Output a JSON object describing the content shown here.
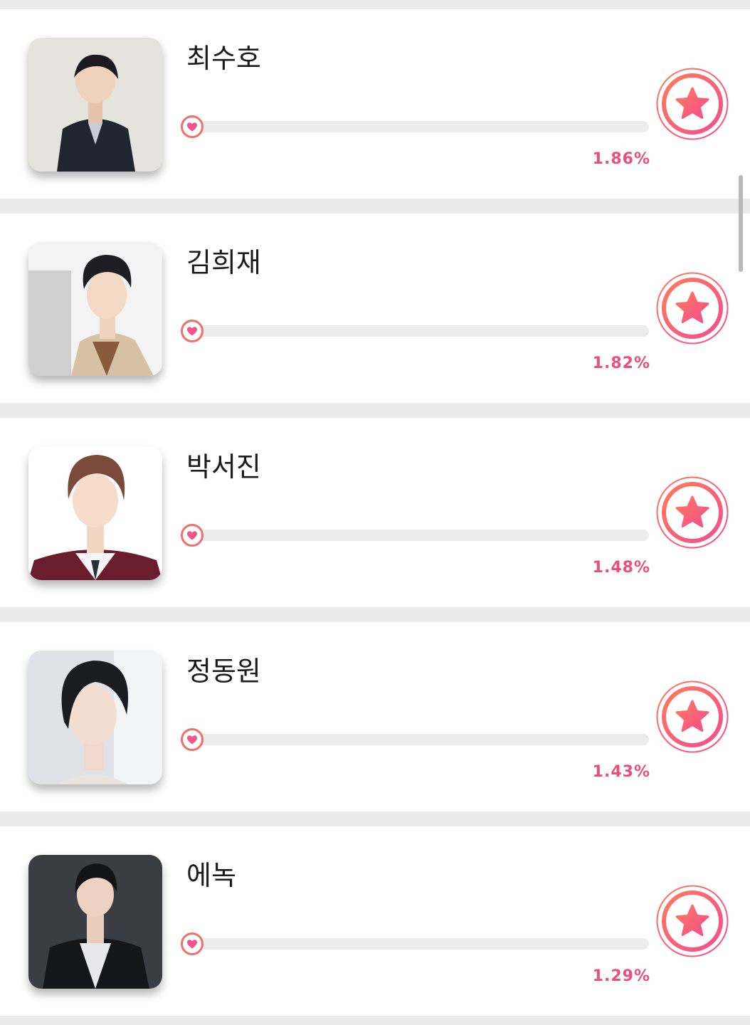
{
  "colors": {
    "accent": "#ea4f7b",
    "accent_gradient_start": "#ff7a5c",
    "accent_gradient_end": "#f24e8e",
    "progress_track": "#ececec",
    "separator": "#ebebeb"
  },
  "icons": {
    "progress_marker": "heart-icon",
    "vote_button": "star-icon"
  },
  "ranking": [
    {
      "name": "최수호",
      "percent_label": "1.86%",
      "progress_fraction": 0.0186
    },
    {
      "name": "김희재",
      "percent_label": "1.82%",
      "progress_fraction": 0.0182
    },
    {
      "name": "박서진",
      "percent_label": "1.48%",
      "progress_fraction": 0.0148
    },
    {
      "name": "정동원",
      "percent_label": "1.43%",
      "progress_fraction": 0.0143
    },
    {
      "name": "에녹",
      "percent_label": "1.29%",
      "progress_fraction": 0.0129
    }
  ]
}
